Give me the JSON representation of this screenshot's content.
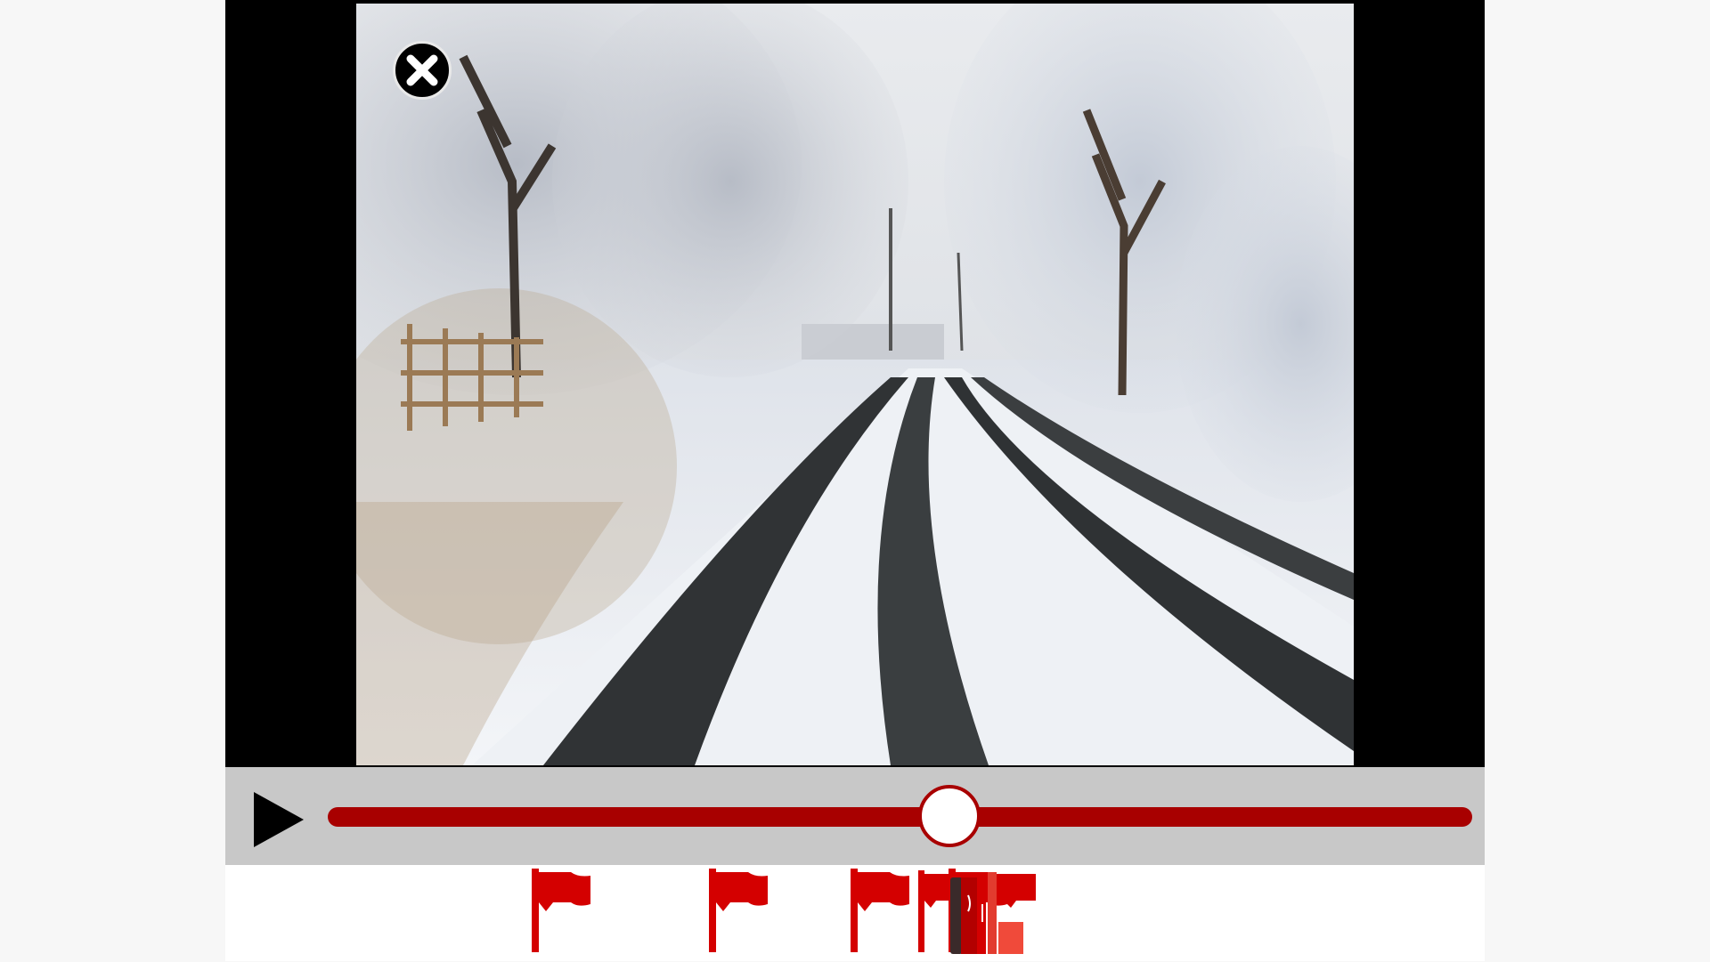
{
  "video": {
    "scene": "snowy-country-road"
  },
  "player": {
    "close_icon": "close-icon",
    "play_icon": "play-icon",
    "playback_progress": 0.543,
    "colors": {
      "accent": "#a80000",
      "control_bar": "#c8c8c8",
      "flag": "#d40000"
    }
  },
  "markers": {
    "flag_icon": "flag-icon",
    "flag_positions": [
      0.246,
      0.387,
      0.499,
      0.577
    ],
    "cluster_icon": "stacked-markers-icon"
  }
}
